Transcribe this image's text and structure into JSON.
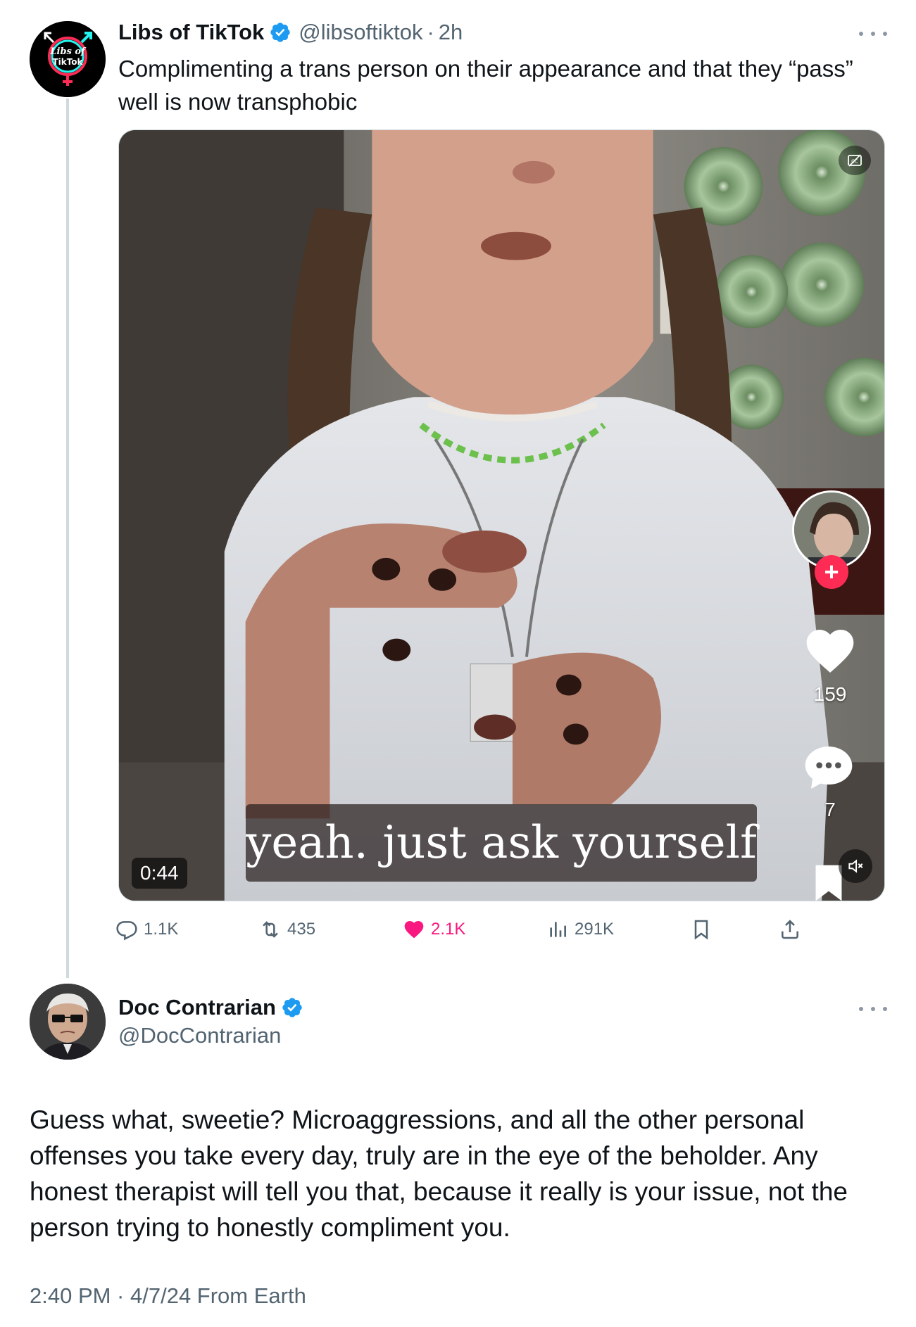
{
  "tweet": {
    "author_name": "Libs of TikTok",
    "handle": "@libsoftiktok",
    "separator": "·",
    "time": "2h",
    "text": "Complimenting a trans person on their appearance and that they “pass” well is now transphobic",
    "avatar_logo_line1": "Libs of",
    "avatar_logo_line2": "TikTok",
    "video": {
      "duration": "0:44",
      "caption": "yeah. just ask yourself",
      "tiktok_likes": "159",
      "tiktok_comments": "7"
    },
    "stats": {
      "replies": "1.1K",
      "reposts": "435",
      "likes": "2.1K",
      "views": "291K"
    }
  },
  "reply": {
    "author_name": "Doc Contrarian",
    "handle": "@DocContrarian",
    "text": "Guess what, sweetie? Microaggressions, and all the other personal offenses you take every day, truly are in the eye of the beholder. Any honest therapist will tell you that, because it really is your issue, not the person trying to honestly compliment you.",
    "meta": "2:40 PM · 4/7/24 From Earth"
  },
  "colors": {
    "verified": "#1d9bf0",
    "like_active": "#f91880",
    "secondary_text": "#536471",
    "tiktok_plus": "#fe2c55"
  },
  "icons": [
    "verified-badge-icon",
    "more-options-icon",
    "reply-icon",
    "repost-icon",
    "heart-icon",
    "views-icon",
    "bookmark-icon",
    "share-icon",
    "captions-icon",
    "mute-icon"
  ]
}
